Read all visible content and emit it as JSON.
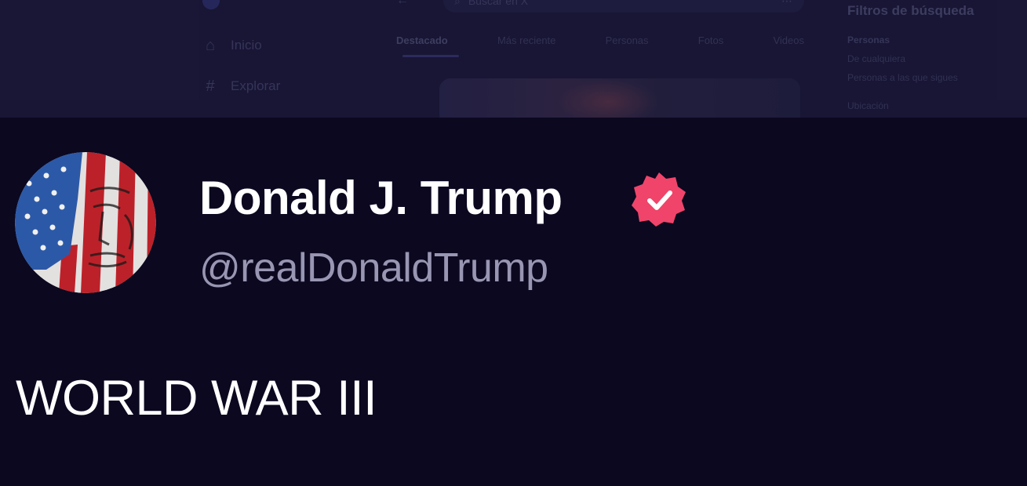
{
  "background": {
    "nav": {
      "home_label": "Inicio",
      "explore_label": "Explorar"
    },
    "search": {
      "placeholder": "Buscar en X"
    },
    "tabs": [
      "Destacado",
      "Más reciente",
      "Personas",
      "Fotos",
      "Videos"
    ],
    "active_tab": "Destacado",
    "filters": {
      "title": "Filtros de búsqueda",
      "people_header": "Personas",
      "people_options": [
        "De cualquiera",
        "Personas a las que sigues"
      ],
      "location_header": "Ubicación"
    }
  },
  "tweet": {
    "display_name": "Donald J. Trump",
    "handle": "@realDonaldTrump",
    "text": "WORLD WAR III",
    "verified": true
  },
  "icons": {
    "verified_badge": "verified-badge-icon",
    "home": "home-icon",
    "explore": "hashtag-icon",
    "back": "back-arrow-icon",
    "search": "search-icon",
    "more": "more-icon"
  },
  "colors": {
    "background": "#0b0820",
    "badge": "#f0446a",
    "name": "#ffffff",
    "handle": "#9896b2"
  }
}
